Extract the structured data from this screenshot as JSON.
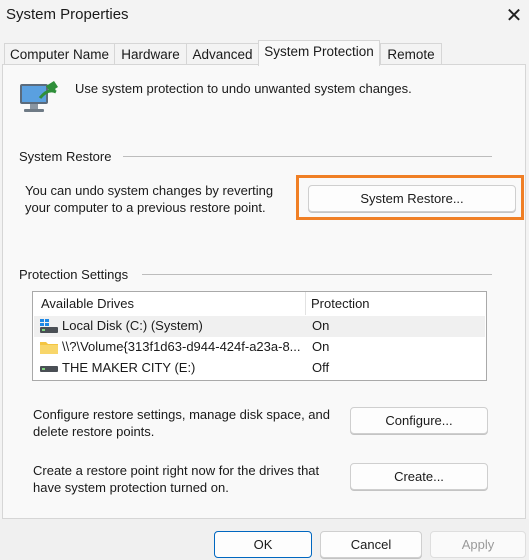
{
  "window": {
    "title": "System Properties",
    "close_glyph": "✕"
  },
  "tabs": [
    {
      "label": "Computer Name",
      "active": false
    },
    {
      "label": "Hardware",
      "active": false
    },
    {
      "label": "Advanced",
      "active": false
    },
    {
      "label": "System Protection",
      "active": true
    },
    {
      "label": "Remote",
      "active": false
    }
  ],
  "intro": {
    "text": "Use system protection to undo unwanted system changes.",
    "icon": "computer-shield-icon"
  },
  "system_restore": {
    "group_label": "System Restore",
    "description_line1": "You can undo system changes by reverting",
    "description_line2": "your computer to a previous restore point.",
    "button_label": "System Restore...",
    "highlight_color": "#f07f25"
  },
  "protection": {
    "group_label": "Protection Settings",
    "columns": {
      "drives": "Available Drives",
      "protection": "Protection"
    },
    "drives": [
      {
        "name": "Local Disk (C:) (System)",
        "protection": "On",
        "icon": "windows-drive-icon",
        "selected": true
      },
      {
        "name": "\\\\?\\Volume{313f1d63-d944-424f-a23a-8...",
        "protection": "On",
        "icon": "folder-icon",
        "selected": false
      },
      {
        "name": "THE MAKER CITY (E:)",
        "protection": "Off",
        "icon": "drive-icon",
        "selected": false
      }
    ],
    "configure_line1": "Configure restore settings, manage disk space, and",
    "configure_line2": "delete restore points.",
    "configure_button": "Configure...",
    "create_line1": "Create a restore point right now for the drives that",
    "create_line2": "have system protection turned on.",
    "create_button": "Create..."
  },
  "footer": {
    "ok": "OK",
    "cancel": "Cancel",
    "apply": "Apply"
  }
}
